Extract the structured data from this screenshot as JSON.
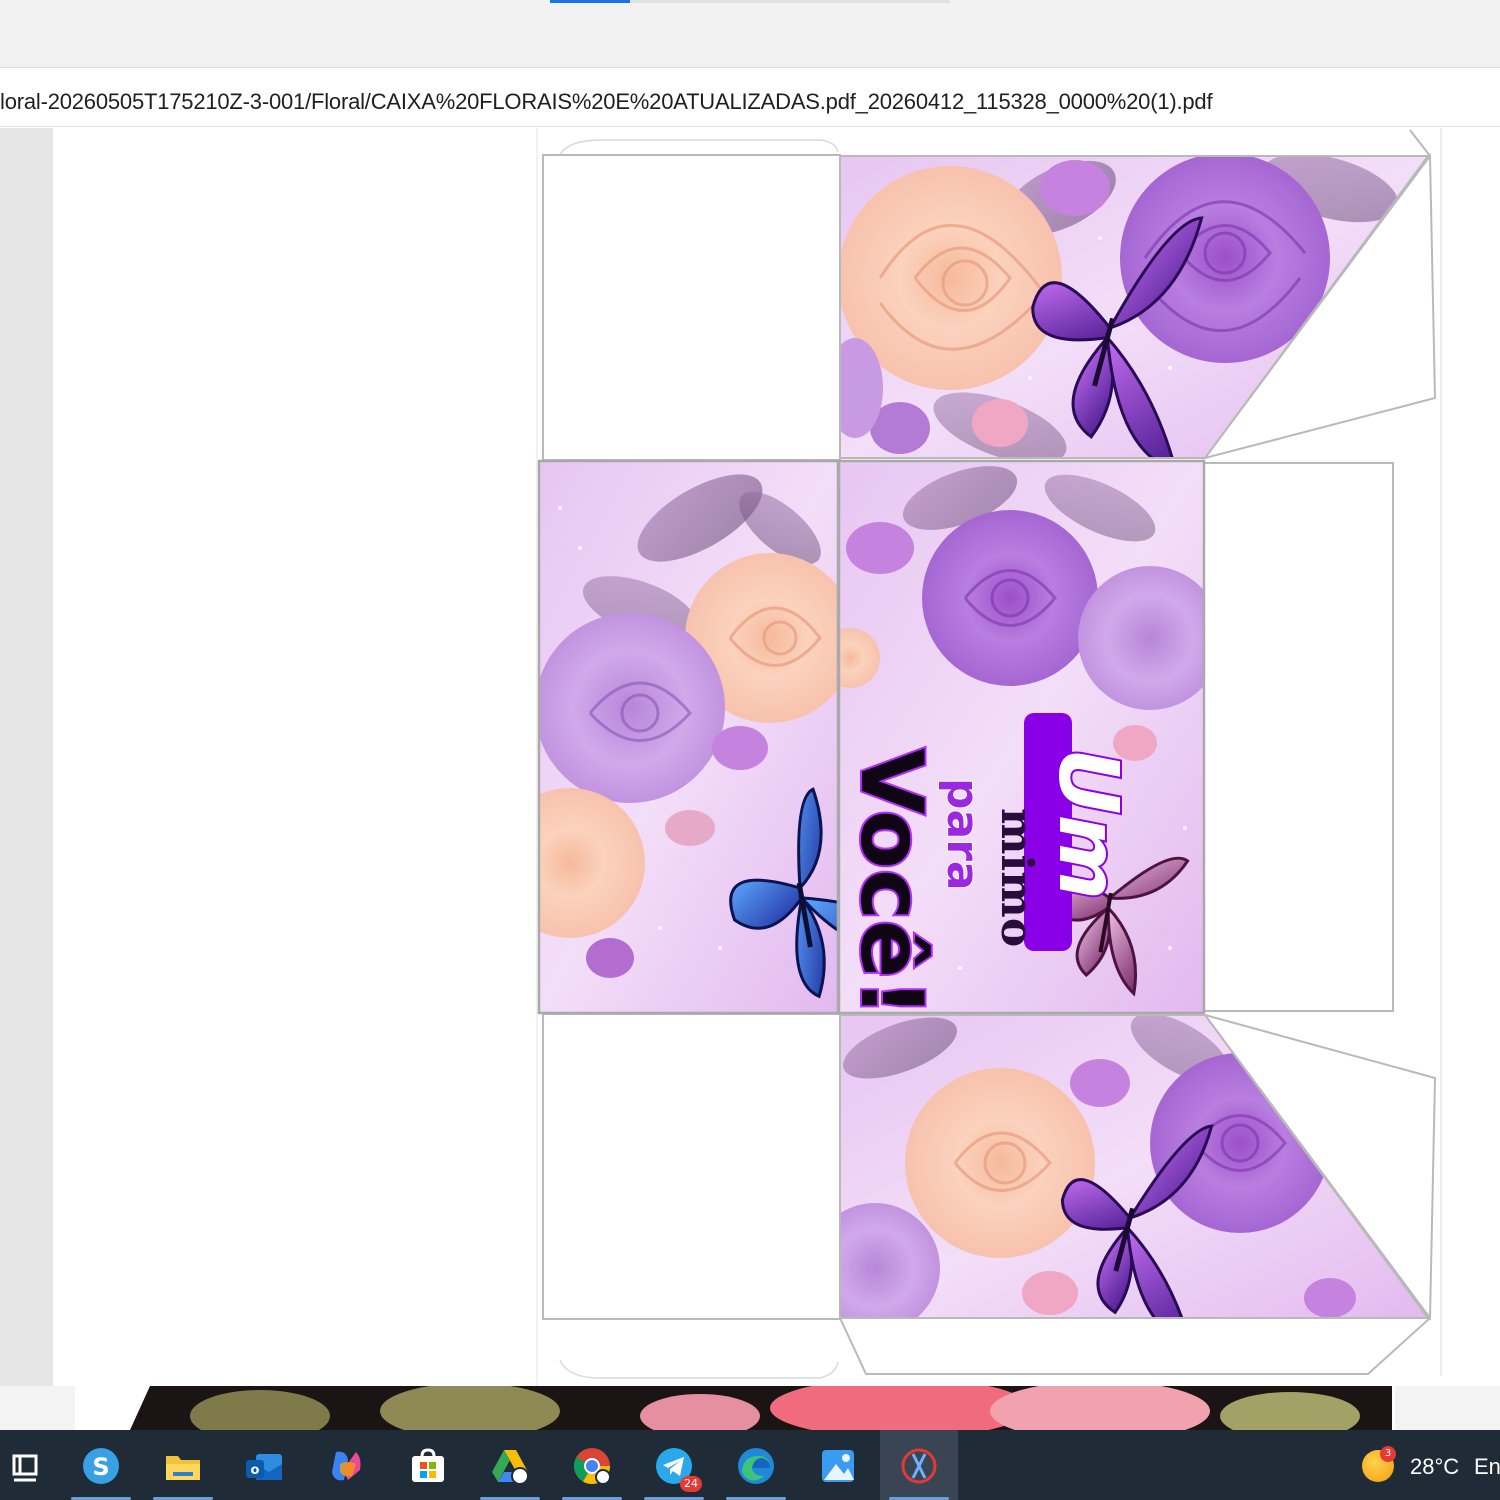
{
  "browser": {
    "address": "loral-20260505T175210Z-3-001/Floral/CAIXA%20FLORAIS%20E%20ATUALIZADAS.pdf_20260412_115328_0000%20(1).pdf"
  },
  "artwork": {
    "line1": "Um",
    "line2": "mimo",
    "line3": "para",
    "line4": "Você!"
  },
  "taskbar": {
    "apps": [
      {
        "name": "task-view",
        "icon": "task-view-icon"
      },
      {
        "name": "skype",
        "icon": "skype-icon"
      },
      {
        "name": "file-explorer",
        "icon": "folder-icon"
      },
      {
        "name": "outlook",
        "icon": "outlook-icon"
      },
      {
        "name": "copilot",
        "icon": "copilot-icon"
      },
      {
        "name": "microsoft-store",
        "icon": "store-icon"
      },
      {
        "name": "google-drive",
        "icon": "drive-icon"
      },
      {
        "name": "chrome",
        "icon": "chrome-icon"
      },
      {
        "name": "telegram",
        "icon": "telegram-icon",
        "badge": "24"
      },
      {
        "name": "edge",
        "icon": "edge-icon"
      },
      {
        "name": "photos",
        "icon": "photos-icon"
      },
      {
        "name": "snipping-tool",
        "icon": "snip-icon"
      }
    ],
    "weather_badge": "3",
    "temperature": "28°C",
    "language": "En"
  },
  "colors": {
    "accent": "#1a73e8",
    "taskbar": "#1f2b37",
    "lilac": "#d8a8ec",
    "purple_text": "#8a00e6"
  }
}
